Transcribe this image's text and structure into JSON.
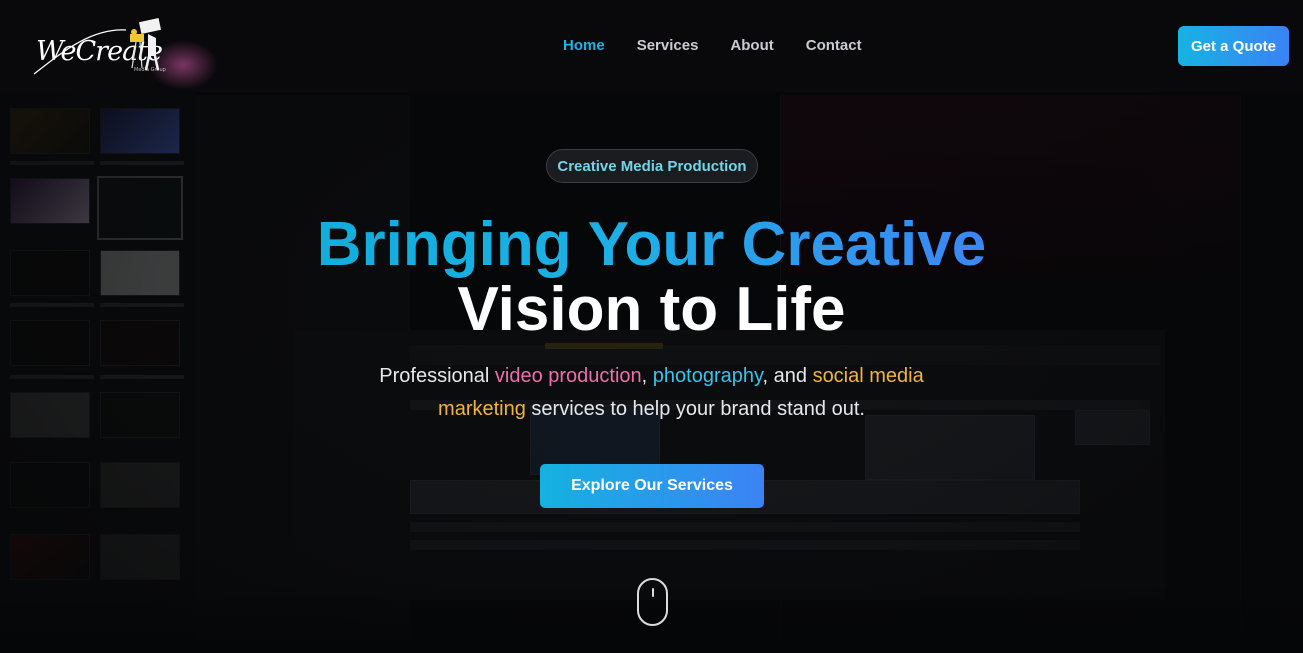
{
  "brand": {
    "logo_text": "WeCreate",
    "logo_sub": "Media Group"
  },
  "nav": {
    "items": [
      {
        "label": "Home",
        "active": true
      },
      {
        "label": "Services",
        "active": false
      },
      {
        "label": "About",
        "active": false
      },
      {
        "label": "Contact",
        "active": false
      }
    ],
    "cta_label": "Get a Quote"
  },
  "hero": {
    "badge": "Creative Media Production",
    "headline_line1": "Bringing Your Creative",
    "headline_line2": "Vision to Life",
    "subtext_parts": {
      "p1": "Professional ",
      "h1": "video production",
      "p2": ", ",
      "h2": "photography",
      "p3": ", and ",
      "h3": "social media marketing",
      "p4": " services to help your brand stand out."
    },
    "cta_label": "Explore Our Services"
  },
  "colors": {
    "accent_cyan": "#1eb3e0",
    "accent_blue": "#3b82f6",
    "highlight_pink": "#ef6fae",
    "highlight_cyan": "#35c4ec",
    "highlight_amber": "#f2b53a",
    "background": "#060708"
  },
  "icons": {
    "scroll_indicator": "mouse-scroll-icon",
    "logo_mark": "camera-operator-icon"
  }
}
